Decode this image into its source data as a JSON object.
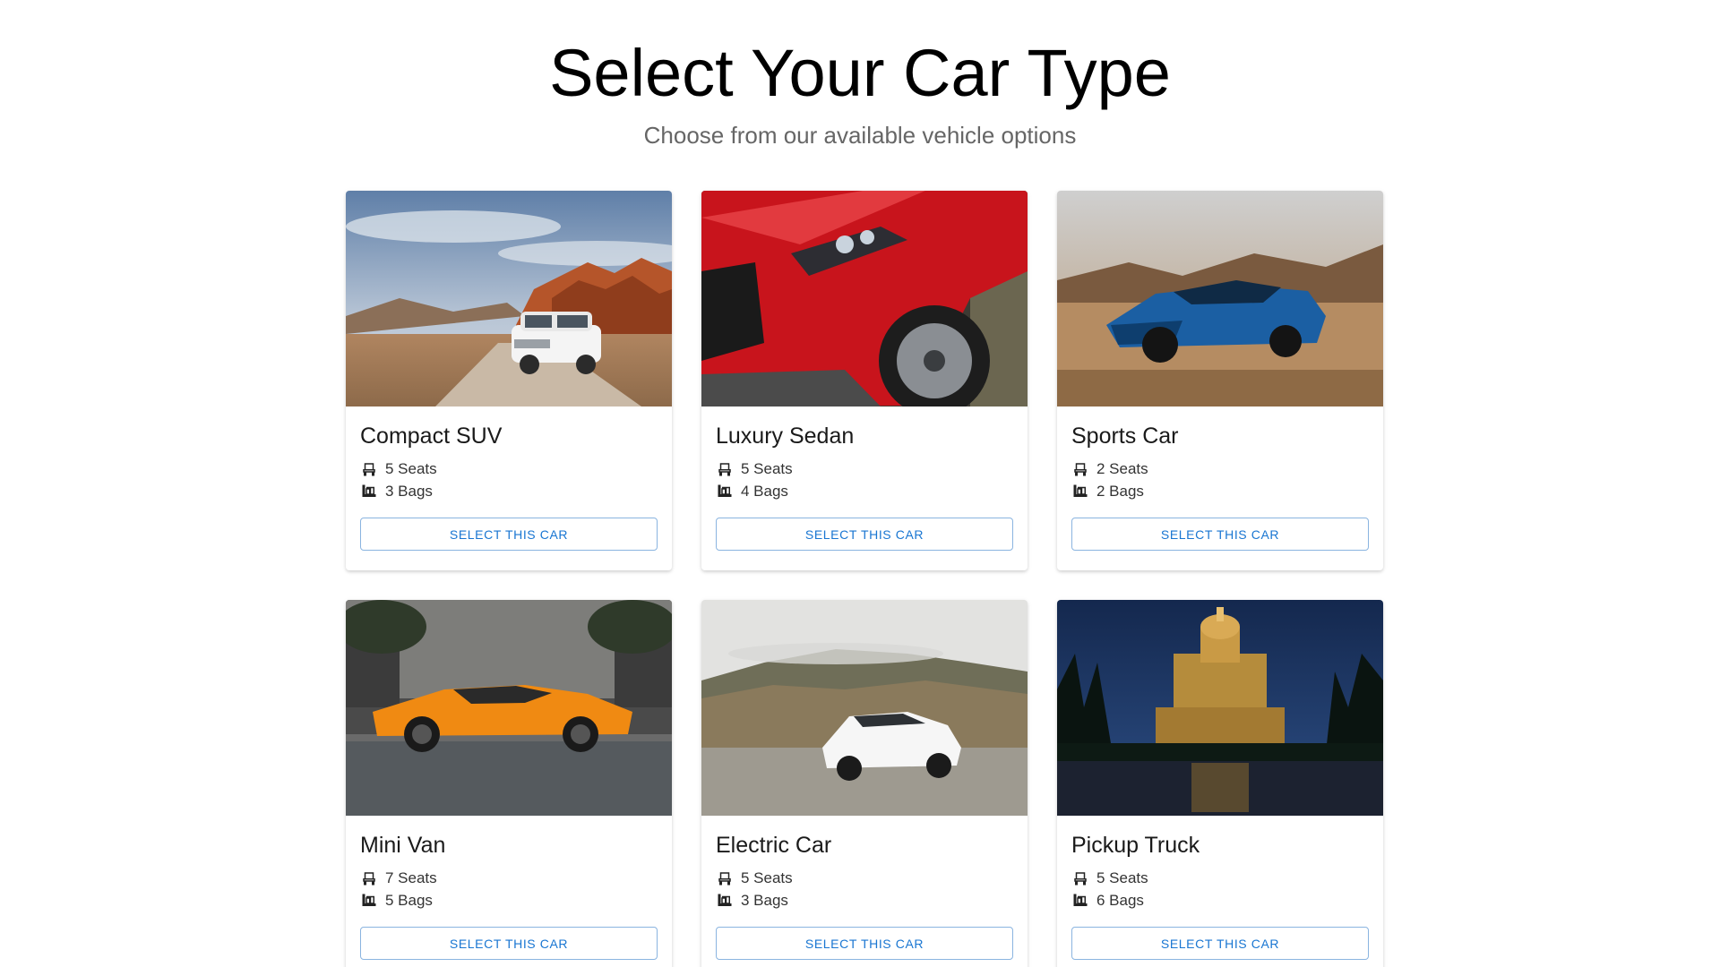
{
  "header": {
    "title": "Select Your Car Type",
    "subtitle": "Choose from our available vehicle options"
  },
  "cars": [
    {
      "name": "Compact SUV",
      "seats": "5 Seats",
      "bags": "3 Bags",
      "button": "SELECT THIS CAR",
      "image": "white-suv-desert-photo"
    },
    {
      "name": "Luxury Sedan",
      "seats": "5 Seats",
      "bags": "4 Bags",
      "button": "SELECT THIS CAR",
      "image": "red-car-front-closeup-photo"
    },
    {
      "name": "Sports Car",
      "seats": "2 Seats",
      "bags": "2 Bags",
      "button": "SELECT THIS CAR",
      "image": "blue-sports-car-desert-photo"
    },
    {
      "name": "Mini Van",
      "seats": "7 Seats",
      "bags": "5 Bags",
      "button": "SELECT THIS CAR",
      "image": "orange-supercar-street-photo"
    },
    {
      "name": "Electric Car",
      "seats": "5 Seats",
      "bags": "3 Bags",
      "button": "SELECT THIS CAR",
      "image": "white-electric-car-hills-photo"
    },
    {
      "name": "Pickup Truck",
      "seats": "5 Seats",
      "bags": "6 Bags",
      "button": "SELECT THIS CAR",
      "image": "illuminated-cathedral-night-photo"
    }
  ],
  "icons": {
    "seats": "seat-icon",
    "bags": "luggage-icon"
  },
  "colors": {
    "accent": "#1976d2",
    "button_border": "#8ab4e0",
    "subtitle": "#666666"
  }
}
